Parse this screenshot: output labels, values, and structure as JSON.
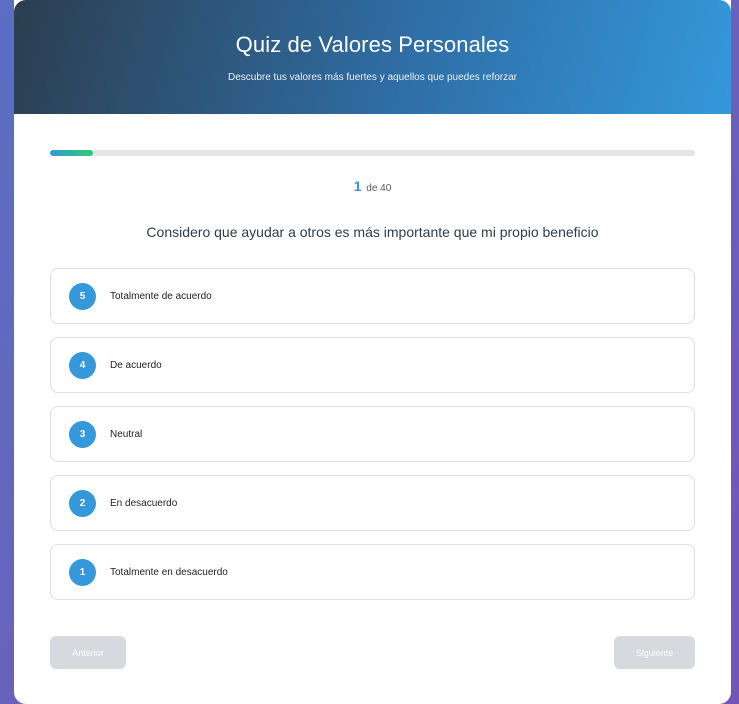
{
  "header": {
    "title": "Quiz de Valores Personales",
    "subtitle": "Descubre tus valores más fuertes y aquellos que puedes reforzar"
  },
  "progress": {
    "fraction": 0.066,
    "current": "1",
    "of_text": "de 40",
    "colors": [
      "#3498db",
      "#2ecc71"
    ]
  },
  "question": {
    "text": "Considero que ayudar a otros es más importante que mi propio beneficio"
  },
  "options": [
    {
      "number": "5",
      "label": "Totalmente de acuerdo"
    },
    {
      "number": "4",
      "label": "De acuerdo"
    },
    {
      "number": "3",
      "label": "Neutral"
    },
    {
      "number": "2",
      "label": "En desacuerdo"
    },
    {
      "number": "1",
      "label": "Totalmente en desacuerdo"
    }
  ],
  "navigation": {
    "prev_label": "Anterior",
    "next_label": "Siguiente"
  },
  "colors": {
    "accent": "#3498db",
    "header_dark": "#2c3e50",
    "disabled_button": "#d6d9dd"
  }
}
